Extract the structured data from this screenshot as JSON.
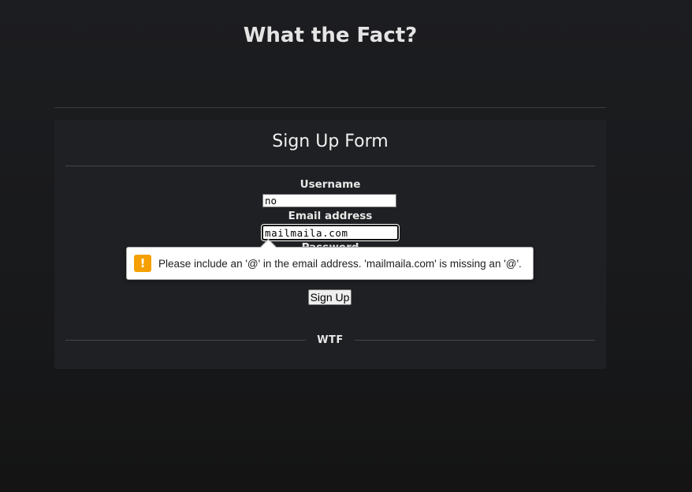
{
  "header": {
    "title": "What the Fact?"
  },
  "form": {
    "title": "Sign Up Form",
    "username": {
      "label": "Username",
      "value": "no"
    },
    "email": {
      "label": "Email address",
      "value": "mailmaila.com"
    },
    "password": {
      "label": "Password"
    },
    "submit_label": "Sign Up"
  },
  "footer": {
    "text": "WTF"
  },
  "validation_tooltip": {
    "icon": "warning-icon",
    "icon_glyph": "!",
    "icon_color": "#f5a000",
    "message": "Please include an '@' in the email address. 'mailmaila.com' is missing an '@'."
  }
}
